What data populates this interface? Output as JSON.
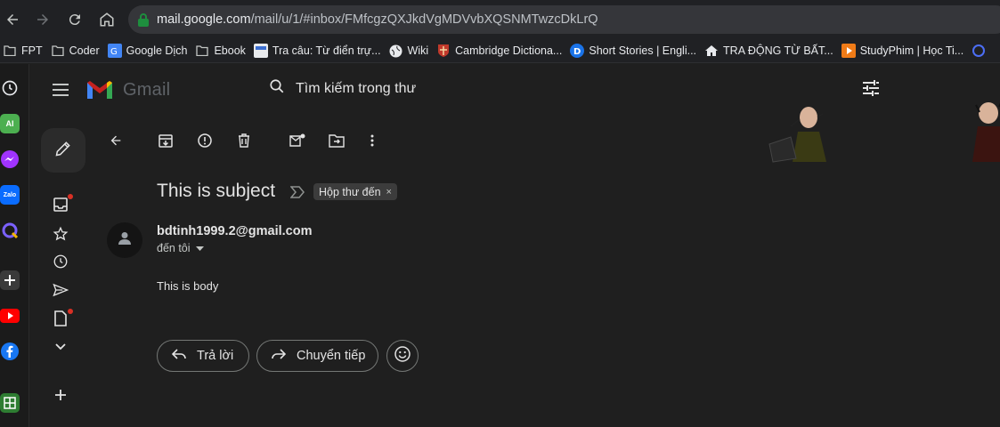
{
  "browser": {
    "url_host": "mail.google.com",
    "url_path": "/mail/u/1/#inbox/FMfcgzQXJkdVgMDVvbXQSNMTwzcDkLrQ"
  },
  "bookmarks": [
    {
      "label": "FPT",
      "icon": "folder-icon"
    },
    {
      "label": "Coder",
      "icon": "folder-icon"
    },
    {
      "label": "Google Dịch",
      "icon": "google-translate-icon"
    },
    {
      "label": "Ebook",
      "icon": "folder-icon"
    },
    {
      "label": "Tra câu: Từ điển trự...",
      "icon": "dictionary-icon"
    },
    {
      "label": "Wiki",
      "icon": "globe-icon"
    },
    {
      "label": "Cambridge Dictiona...",
      "icon": "cambridge-icon"
    },
    {
      "label": "Short Stories | Engli...",
      "icon": "stories-icon"
    },
    {
      "label": "TRA ĐỘNG TỪ BẤT...",
      "icon": "house-icon"
    },
    {
      "label": "StudyPhim | Học Ti...",
      "icon": "play-icon"
    }
  ],
  "gmail": {
    "logo_text": "Gmail",
    "search_placeholder": "Tìm kiếm trong thư"
  },
  "email": {
    "subject": "This is subject",
    "label": "Hộp thư đến",
    "label_close": "×",
    "sender": "bdtinh1999.2@gmail.com",
    "recipient": "đến tôi",
    "body": "This is body"
  },
  "actions": {
    "reply_label": "Trả lời",
    "forward_label": "Chuyển tiếp"
  },
  "colors": {
    "background": "#1f1f1f",
    "unread_dot": "#d93025",
    "secure_lock": "#1e8e3e"
  }
}
